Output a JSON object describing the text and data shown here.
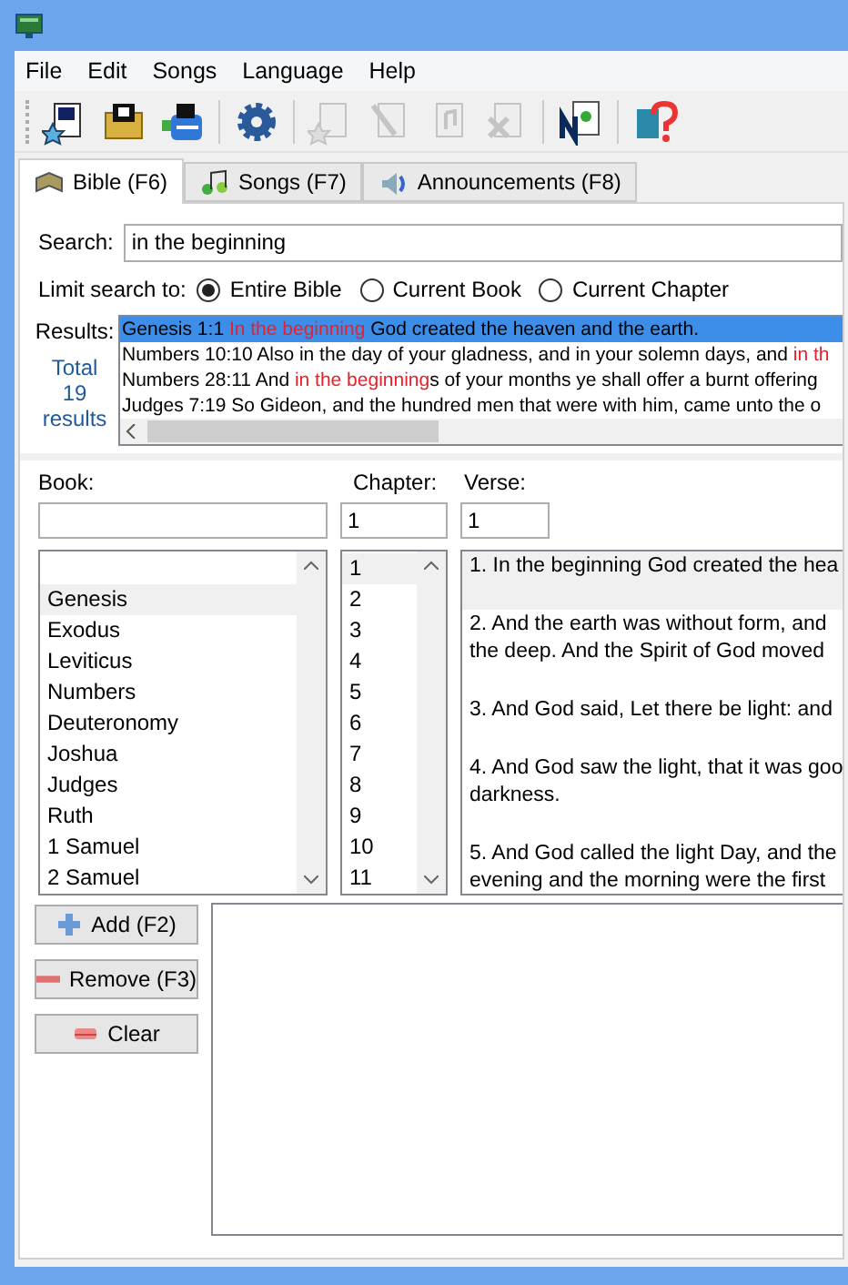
{
  "menu": [
    "File",
    "Edit",
    "Songs",
    "Language",
    "Help"
  ],
  "toolbar": [
    [
      {
        "disabled": false
      },
      {
        "disabled": false
      },
      {
        "disabled": false
      }
    ],
    [
      {
        "disabled": false
      }
    ],
    [
      {
        "disabled": true
      },
      {
        "disabled": true
      },
      {
        "disabled": true
      },
      {
        "disabled": true
      }
    ],
    [
      {
        "disabled": false
      }
    ],
    [
      {
        "disabled": false
      }
    ]
  ],
  "tabs": [
    {
      "label": "Bible (F6)",
      "selected": true
    },
    {
      "label": "Songs (F7)",
      "selected": false
    },
    {
      "label": "Announcements (F8)",
      "selected": false
    }
  ],
  "search": {
    "label": "Search:",
    "value": "in the beginning"
  },
  "limit": {
    "label": "Limit search to:",
    "options": [
      {
        "label": "Entire Bible",
        "selected": true
      },
      {
        "label": "Current Book",
        "selected": false
      },
      {
        "label": "Current Chapter",
        "selected": false
      }
    ]
  },
  "results": {
    "label": "Results:",
    "total": [
      "Total",
      "19",
      "results"
    ],
    "rows": [
      {
        "selected": true,
        "parts": [
          {
            "text": "Genesis 1:1 ",
            "hit": false
          },
          {
            "text": "In the beginning",
            "hit": true
          },
          {
            "text": " God created the heaven and the earth.",
            "hit": false
          }
        ]
      },
      {
        "selected": false,
        "parts": [
          {
            "text": "Numbers 10:10 Also in the day of your gladness, and in your solemn days, and ",
            "hit": false
          },
          {
            "text": "in th",
            "hit": true
          }
        ]
      },
      {
        "selected": false,
        "parts": [
          {
            "text": "Numbers 28:11 And ",
            "hit": false
          },
          {
            "text": "in the beginning",
            "hit": true
          },
          {
            "text": "s of your months ye shall offer a burnt offering",
            "hit": false
          }
        ]
      },
      {
        "selected": false,
        "parts": [
          {
            "text": "Judges 7:19 So Gideon, and the hundred men that were with him, came unto the o",
            "hit": false
          }
        ]
      }
    ]
  },
  "reference": {
    "book_label": "Book:",
    "chapter_label": "Chapter:",
    "verse_label": "Verse:",
    "chapter": "1",
    "verse": "1"
  },
  "books": [
    {
      "name": "Genesis",
      "selected": true
    },
    {
      "name": "Exodus",
      "selected": false
    },
    {
      "name": "Leviticus",
      "selected": false
    },
    {
      "name": "Numbers",
      "selected": false
    },
    {
      "name": "Deuteronomy",
      "selected": false
    },
    {
      "name": "Joshua",
      "selected": false
    },
    {
      "name": "Judges",
      "selected": false
    },
    {
      "name": "Ruth",
      "selected": false
    },
    {
      "name": "1 Samuel",
      "selected": false
    },
    {
      "name": "2 Samuel",
      "selected": false
    }
  ],
  "chapters": [
    {
      "name": "1",
      "selected": true
    },
    {
      "name": "2",
      "selected": false
    },
    {
      "name": "3",
      "selected": false
    },
    {
      "name": "4",
      "selected": false
    },
    {
      "name": "5",
      "selected": false
    },
    {
      "name": "6",
      "selected": false
    },
    {
      "name": "7",
      "selected": false
    },
    {
      "name": "8",
      "selected": false
    },
    {
      "name": "9",
      "selected": false
    },
    {
      "name": "10",
      "selected": false
    },
    {
      "name": "11",
      "selected": false
    }
  ],
  "verses": [
    {
      "selected": true,
      "lines": [
        "1. In the beginning God created the hea"
      ]
    },
    {
      "selected": false,
      "lines": [
        "2. And the earth was without form, and",
        "the deep. And the Spirit of God moved"
      ]
    },
    {
      "selected": false,
      "lines": [
        "3. And God said, Let there be light: and"
      ]
    },
    {
      "selected": false,
      "lines": [
        "4. And God saw the light, that it was goo",
        "darkness."
      ]
    },
    {
      "selected": false,
      "lines": [
        "5. And God called the light Day, and the",
        "evening and the morning were the first"
      ]
    }
  ],
  "buttons": [
    {
      "kind": "add",
      "label": "Add (F2)"
    },
    {
      "kind": "remove",
      "label": "Remove (F3)"
    },
    {
      "kind": "clear",
      "label": "Clear"
    }
  ]
}
